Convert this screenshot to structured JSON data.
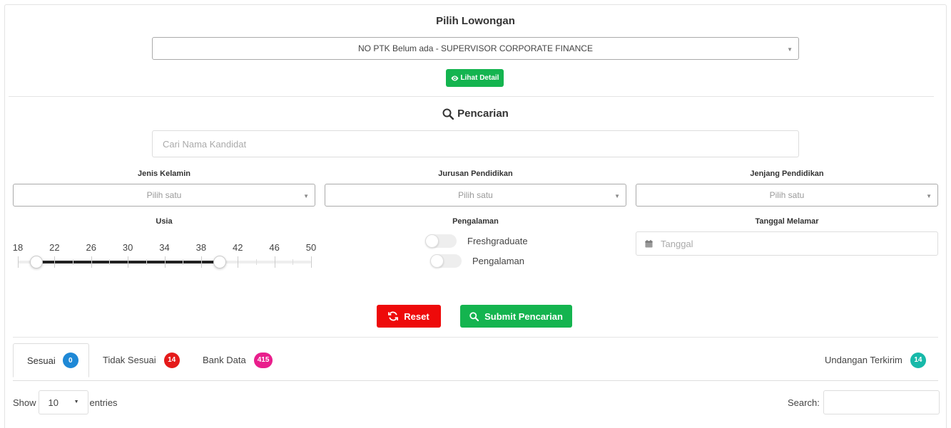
{
  "vacancy": {
    "title": "Pilih Lowongan",
    "selected": "NO PTK Belum ada - SUPERVISOR CORPORATE FINANCE",
    "detail_button": "Lihat Detail"
  },
  "search": {
    "title": "Pencarian",
    "candidate_placeholder": "Cari Nama Kandidat"
  },
  "filters": {
    "gender": {
      "label": "Jenis Kelamin",
      "value": "Pilih satu"
    },
    "major": {
      "label": "Jurusan Pendidikan",
      "value": "Pilih satu"
    },
    "level": {
      "label": "Jenjang Pendidikan",
      "value": "Pilih satu"
    },
    "age": {
      "label": "Usia",
      "ticks": [
        "18",
        "22",
        "26",
        "30",
        "34",
        "38",
        "42",
        "46",
        "50"
      ],
      "min": 18,
      "max": 50,
      "range": [
        20,
        40
      ]
    },
    "experience": {
      "label": "Pengalaman",
      "options": [
        "Freshgraduate",
        "Pengalaman"
      ]
    },
    "apply_date": {
      "label": "Tanggal Melamar",
      "placeholder": "Tanggal"
    }
  },
  "actions": {
    "reset": "Reset",
    "submit": "Submit Pencarian"
  },
  "tabs": [
    {
      "label": "Sesuai",
      "count": "0",
      "color": "#1e88d6"
    },
    {
      "label": "Tidak Sesuai",
      "count": "14",
      "color": "#e51a1a"
    },
    {
      "label": "Bank Data",
      "count": "415",
      "color": "#e91e8c"
    },
    {
      "label": "Undangan Terkirim",
      "count": "14",
      "color": "#17b9a9"
    }
  ],
  "table_controls": {
    "show": "Show",
    "entries_value": "10",
    "entries": "entries",
    "search": "Search:"
  }
}
